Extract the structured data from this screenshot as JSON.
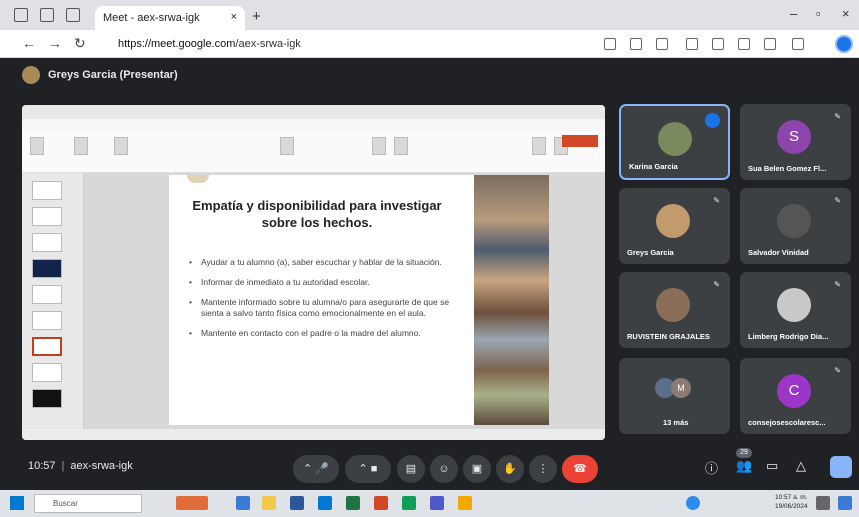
{
  "browser": {
    "tab_title": "Meet - aex-srwa-igk",
    "tab_audio_icon": "speaker-icon",
    "url_host": "https://meet.google.com",
    "url_path": "/aex-srwa-igk"
  },
  "meet": {
    "presenter_label": "Greys Garcia (Presentar)",
    "slide": {
      "title": "Empatía y disponibilidad para investigar sobre los hechos.",
      "bullets": [
        "Ayudar a tu alumno (a), saber escuchar y hablar de la situación.",
        "Informar de inmediato a tu autoridad escolar.",
        "Mantente informado sobre tu alumna/o para asegurarte de que se sienta a salvo tanto física como emocionalmente en el aula.",
        "Mantente en contacto con el padre o la madre del alumno."
      ]
    },
    "participants": [
      {
        "name": "Karina Garcia",
        "active": true
      },
      {
        "name": "Sua Belen Gomez Fl...",
        "letter": "S",
        "letter_color": "#8e44ad"
      },
      {
        "name": "Greys Garcia"
      },
      {
        "name": "Salvador Vinidad"
      },
      {
        "name": "RUVISTEIN GRAJALES"
      },
      {
        "name": "Limberg Rodrigo Dia..."
      },
      {
        "name": "13 más",
        "stack_letter": "M"
      },
      {
        "name": "consejosescolaresc...",
        "letter": "C",
        "letter_color": "#9b36c9"
      }
    ],
    "time": "10:57",
    "meeting_code": "aex-srwa-igk",
    "people_count": "29"
  },
  "taskbar": {
    "search_placeholder": "Buscar",
    "clock_time": "10:57 a. m.",
    "clock_date": "19/06/2024"
  },
  "colors": {
    "accent": "#1a73e8",
    "end_call": "#ea4335",
    "meet_bg": "#202124"
  }
}
